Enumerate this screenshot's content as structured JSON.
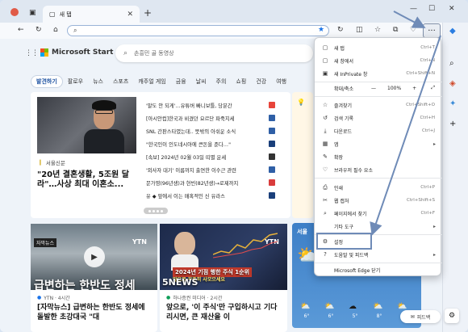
{
  "browser": {
    "tab_title": "새 탭",
    "tab_close": "✕",
    "new_tab": "+",
    "window_controls": [
      "—",
      "☐",
      "✕"
    ]
  },
  "page": {
    "brand": "Microsoft Start",
    "search_placeholder": "손흥민 골 동영상",
    "nav_tabs": [
      "발견하기",
      "팔로우",
      "뉴스",
      "스포츠",
      "캐주얼 게임",
      "금융",
      "날씨",
      "주의",
      "쇼핑",
      "건강",
      "여행"
    ],
    "main_story": {
      "source": "서울신문",
      "headline": "\"20년 결혼생활, 5조원 달라\"…사상 최대 이혼소..."
    },
    "news_list": [
      {
        "text": "'말도 안 되게'…유튜버 빠니보틀, 당분간",
        "logo_color": "#e8443a"
      },
      {
        "text": "[아시안컵]한국과 비겼던 요르단 파죽지세",
        "logo_color": "#2f5fa6"
      },
      {
        "text": "SNL 간판스타였는데.. 뜻밖의 아쉬운 소식",
        "logo_color": "#2f5fa6"
      },
      {
        "text": "\"한국인이 인도네시아에 큰돈을 준다…\"",
        "logo_color": "#1a3f7a"
      },
      {
        "text": "[속보] 2024년 02월 03일 띠별 운세",
        "logo_color": "#333333"
      },
      {
        "text": "'외사자 대기' 이름까지 출연한 이수근 관련",
        "logo_color": "#2f5fa6"
      },
      {
        "text": "문가영(96년생)과 현빈(82년생)→로제까지",
        "logo_color": "#d93c3c"
      },
      {
        "text": "유 ◆ 앞에서 이는 매혹적인 신 유라스",
        "logo_color": "#1a3f7a"
      }
    ],
    "card2": {
      "badge": "자막뉴스",
      "channel": "YTN",
      "overlay_text": "급변하는 한반도 정세",
      "source": "YTN · 4시간",
      "headline": "[자막뉴스] 급변하는 한반도 정세에 돌발한 초강대국 \"대"
    },
    "card3": {
      "channel": "YTN",
      "overlay_text": "2024년 기점 행한 주식 1순위",
      "overlay_sub": "앞으로 꾸준히 사모으세요",
      "tag": "5NEWS",
      "source": "하나증권 미디어 · 2시간",
      "headline": "앞으로, '이 주식'만 구입하시고 기다리시면, 큰 재산을 이"
    },
    "weather": {
      "city": "서울",
      "days": [
        "6°",
        "6°",
        "5°",
        "8°",
        "6°"
      ]
    },
    "feedback_label": "피드백"
  },
  "menu": {
    "items": [
      {
        "icon": "▢",
        "label": "새 탭",
        "shortcut": "Ctrl+T"
      },
      {
        "icon": "▢",
        "label": "새 창에서",
        "shortcut": "Ctrl+N"
      },
      {
        "icon": "▣",
        "label": "새 InPrivate 창",
        "shortcut": "Ctrl+Shift+N"
      }
    ],
    "zoom": {
      "label": "확대/축소",
      "minus": "—",
      "value": "100%",
      "plus": "+",
      "expand": "⤢"
    },
    "items2": [
      {
        "icon": "☆",
        "label": "즐겨찾기",
        "shortcut": "Ctrl+Shift+O"
      },
      {
        "icon": "↺",
        "label": "검색 기록",
        "shortcut": "Ctrl+H"
      },
      {
        "icon": "⤓",
        "label": "다운로드",
        "shortcut": "Ctrl+J"
      },
      {
        "icon": "▦",
        "label": "앱",
        "arrow": "▸"
      },
      {
        "icon": "✎",
        "label": "확장",
        "shortcut": ""
      },
      {
        "icon": "♡",
        "label": "브라우저 필수 요소",
        "shortcut": ""
      },
      {
        "icon": "⎙",
        "label": "인쇄",
        "shortcut": "Ctrl+P"
      },
      {
        "icon": "✂",
        "label": "웹 캡처",
        "shortcut": "Ctrl+Shift+S"
      },
      {
        "icon": "⌕",
        "label": "페이지에서 찾기",
        "shortcut": "Ctrl+F"
      },
      {
        "icon": "",
        "label": "기타 도구",
        "arrow": "▸"
      },
      {
        "icon": "⚙",
        "label": "설정",
        "shortcut": ""
      },
      {
        "icon": "?",
        "label": "도움말 및 피드백",
        "arrow": "▸"
      },
      {
        "icon": "",
        "label": "Microsoft Edge 닫기",
        "shortcut": ""
      }
    ]
  },
  "colors": {
    "accent": "#1a73e8",
    "annotation_arrow": "#6f8bb7",
    "ms_red": "#f25022",
    "ms_green": "#7fba00",
    "ms_blue": "#00a4ef",
    "ms_yellow": "#ffb900"
  }
}
